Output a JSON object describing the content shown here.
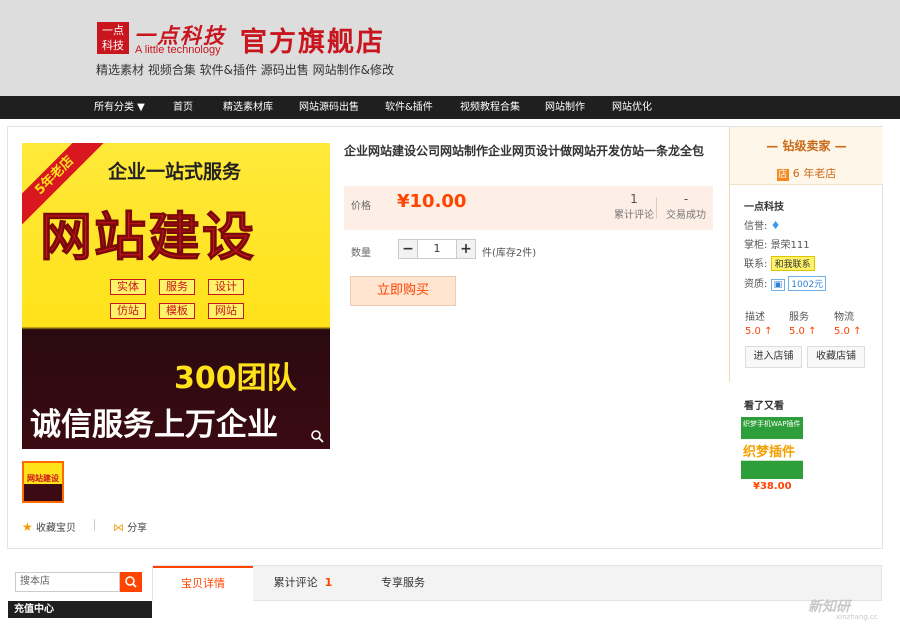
{
  "header": {
    "logo_line1": "一点",
    "logo_line2": "科技",
    "logo_cn": "一点科技",
    "logo_en": "A little technology",
    "store_name": "官方旗舰店",
    "tagline": "精选素材  视频合集  软件&插件  源码出售  网站制作&修改"
  },
  "nav": {
    "items": [
      "所有分类 ▼",
      "首页",
      "精选素材库",
      "网站源码出售",
      "软件&插件",
      "视频教程合集",
      "网站制作",
      "网站优化"
    ]
  },
  "image": {
    "ribbon": "5年老店",
    "line1": "企业一站式服务",
    "line2": "网站建设",
    "tags": [
      "实体",
      "服务",
      "设计",
      "仿站",
      "模板",
      "网站"
    ],
    "line3": "300团队",
    "line4": "诚信服务上万企业",
    "thumb_text": "网站建设"
  },
  "actions": {
    "favorite": "收藏宝贝",
    "share": "分享"
  },
  "product": {
    "title": "企业网站建设公司网站制作企业网页设计做网站开发仿站一条龙全包",
    "price_label": "价格",
    "price": "¥10.00",
    "reviews_count": "1",
    "reviews_label": "累计评论",
    "deals_count": "-",
    "deals_label": "交易成功",
    "qty_label": "数量",
    "qty_minus": "−",
    "qty_value": "1",
    "qty_plus": "+",
    "stock": "件(库存2件)",
    "buy_label": "立即购买"
  },
  "seller": {
    "level": "钻级卖家",
    "years": "6 年老店",
    "shop_badge": "店",
    "name": "一点科技",
    "reputation_label": "信誉:",
    "keeper_label": "掌柜:",
    "keeper": "景荣111",
    "contact_label": "联系:",
    "contact_button": "和我联系",
    "cert_label": "资质:",
    "deposit": "1002元",
    "scores": [
      {
        "label": "描述",
        "value": "5.0 ↑"
      },
      {
        "label": "服务",
        "value": "5.0 ↑"
      },
      {
        "label": "物流",
        "value": "5.0 ↑"
      }
    ],
    "enter_shop": "进入店铺",
    "fav_shop": "收藏店铺"
  },
  "also_viewed": {
    "title": "看了又看",
    "img_top": "织梦手机WAP插件 数据同步 自动建站",
    "img_text": "织梦插件",
    "price": "¥38.00"
  },
  "bottom": {
    "search_placeholder": "搜本店",
    "charge_center": "充值中心",
    "tabs": [
      {
        "label": "宝贝详情",
        "count": ""
      },
      {
        "label": "累计评论",
        "count": "1"
      },
      {
        "label": "专享服务",
        "count": ""
      }
    ]
  },
  "watermark": {
    "text": "新知研",
    "sub": "xinzhang.cc"
  },
  "colors": {
    "brand_red": "#c9151e",
    "price_orange": "#ff4400",
    "nav_bg": "#1f1f1f",
    "header_bg": "#dddddd"
  }
}
